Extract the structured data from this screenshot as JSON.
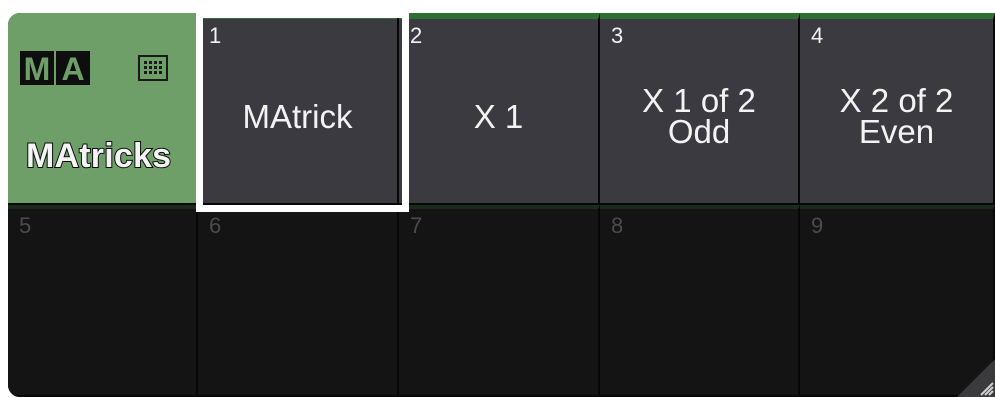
{
  "window": {
    "title": "MAtricks",
    "logo_letters": [
      "M",
      "A"
    ],
    "icon": "grid-icon",
    "resize_icon": "resize-handle-icon",
    "colors": {
      "title_bg": "#6f9f69",
      "filled_cell_bg": "#3b3a40",
      "filled_cell_bar": "#2f6e35",
      "empty_cell_bg": "#141415",
      "selection": "#ffffff"
    }
  },
  "cells": [
    {
      "number": "1",
      "label": "MAtrick",
      "filled": true,
      "selected": true
    },
    {
      "number": "2",
      "label": "X 1",
      "filled": true,
      "selected": false
    },
    {
      "number": "3",
      "label": "X 1 of 2\nOdd",
      "filled": true,
      "selected": false
    },
    {
      "number": "4",
      "label": "X 2 of 2\nEven",
      "filled": true,
      "selected": false
    },
    {
      "number": "5",
      "label": "",
      "filled": false,
      "selected": false
    },
    {
      "number": "6",
      "label": "",
      "filled": false,
      "selected": false
    },
    {
      "number": "7",
      "label": "",
      "filled": false,
      "selected": false
    },
    {
      "number": "8",
      "label": "",
      "filled": false,
      "selected": false
    },
    {
      "number": "9",
      "label": "",
      "filled": false,
      "selected": false
    }
  ]
}
